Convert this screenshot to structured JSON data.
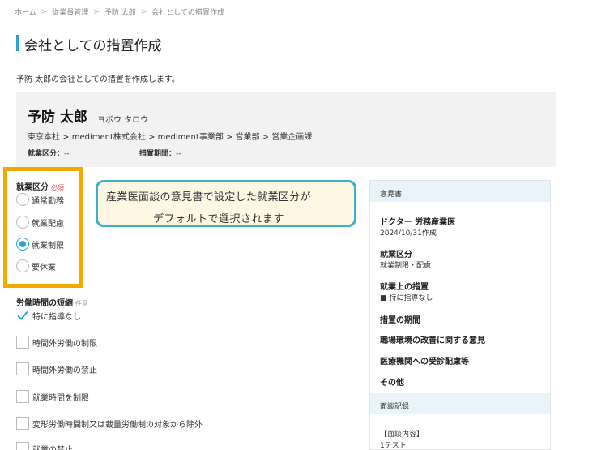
{
  "breadcrumb": {
    "items": [
      "ホーム",
      "従業員管理",
      "予防 太郎",
      "会社としての措置作成"
    ],
    "separator": ">"
  },
  "page": {
    "title": "会社としての措置作成",
    "subtitle": "予防 太郎の会社としての措置を作成します。"
  },
  "profile": {
    "name": "予防 太郎",
    "kana": "ヨボウ タロウ",
    "org_path": "東京本社 > mediment株式会社 > mediment事業部 > 営業部 > 営業企画課",
    "employment_label": "就業区分：",
    "employment_value": "--",
    "period_label": "措置期間：",
    "period_value": "--"
  },
  "form": {
    "employment_class": {
      "label": "就業区分",
      "required_tag": "必須",
      "options": [
        "通常勤務",
        "就業配慮",
        "就業制限",
        "要休業"
      ],
      "selected": "就業制限"
    },
    "working_hours": {
      "label": "労働時間の短縮",
      "optional_tag": "任意",
      "options": [
        {
          "label": "特に指導なし",
          "checked": true
        },
        {
          "label": "時間外労働の制限",
          "checked": false
        },
        {
          "label": "時間外労働の禁止",
          "checked": false
        },
        {
          "label": "就業時間を制限",
          "checked": false
        },
        {
          "label": "変形労働時間制又は裁量労働制の対象から除外",
          "checked": false
        },
        {
          "label": "就業の禁止",
          "checked": false
        }
      ]
    }
  },
  "callout": {
    "line1": "産業医面談の意見書で設定した就業区分が",
    "line2": "デフォルトで選択されます"
  },
  "side_panel": {
    "opinion_header": "意見書",
    "doctor": "ドクター 労務産業医",
    "created": "2024/10/31作成",
    "employment_label": "就業区分",
    "employment_value": "就業制限・配慮",
    "measures_label": "就業上の措置",
    "measures_value": "■ 特に指導なし",
    "period_label": "措置の期間",
    "environment_label": "職場環境の改善に関する意見",
    "medical_label": "医療機関への受診配慮等",
    "other_label": "その他",
    "interview_header": "面談記録",
    "interview_content_label": "【面談内容】",
    "interview_content_value": "1テスト"
  },
  "colors": {
    "accent": "#2aa0d6",
    "highlight": "#f5a800",
    "callout_border": "#3bb0c9",
    "callout_bg": "#fdf7e3"
  }
}
